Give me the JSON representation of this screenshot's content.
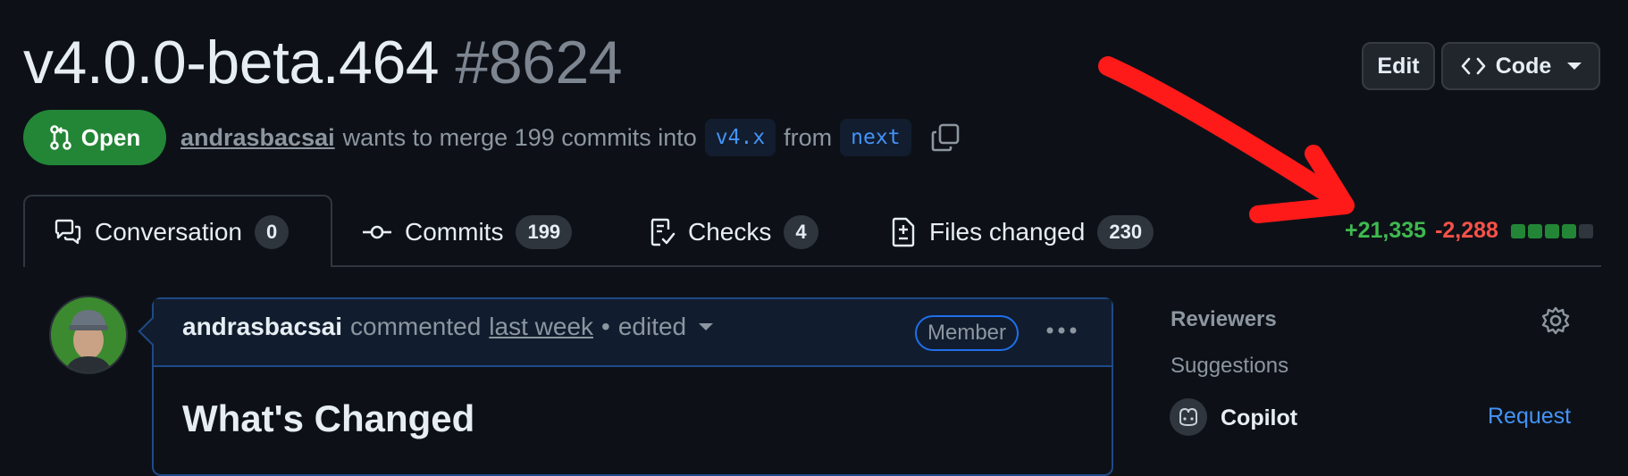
{
  "pr": {
    "title": "v4.0.0-beta.464",
    "number": "#8624",
    "status": "Open",
    "author": "andrasbacsai",
    "merge_text": "wants to merge 199 commits into",
    "base_branch": "v4.x",
    "from_text": "from",
    "head_branch": "next"
  },
  "header_buttons": {
    "edit": "Edit",
    "code": "Code"
  },
  "tabs": [
    {
      "label": "Conversation",
      "count": "0",
      "icon": "comment-discussion-icon",
      "active": true
    },
    {
      "label": "Commits",
      "count": "199",
      "icon": "git-commit-icon",
      "active": false
    },
    {
      "label": "Checks",
      "count": "4",
      "icon": "checklist-icon",
      "active": false
    },
    {
      "label": "Files changed",
      "count": "230",
      "icon": "file-diff-icon",
      "active": false
    }
  ],
  "diffstat": {
    "additions": "+21,335",
    "deletions": "-2,288",
    "blocks": [
      "green",
      "green",
      "green",
      "green",
      "gray"
    ]
  },
  "comment": {
    "author": "andrasbacsai",
    "action": "commented",
    "time": "last week",
    "separator": "•",
    "edited": "edited",
    "role": "Member",
    "heading": "What's Changed"
  },
  "sidebar": {
    "reviewers_title": "Reviewers",
    "suggestions_label": "Suggestions",
    "suggested_reviewer": "Copilot",
    "request_label": "Request"
  },
  "colors": {
    "background": "#0d1117",
    "open_green": "#238636",
    "addition_green": "#3fb950",
    "deletion_red": "#f85149",
    "link_blue": "#4493f8",
    "annotation_arrow": "#ff1a1a"
  }
}
